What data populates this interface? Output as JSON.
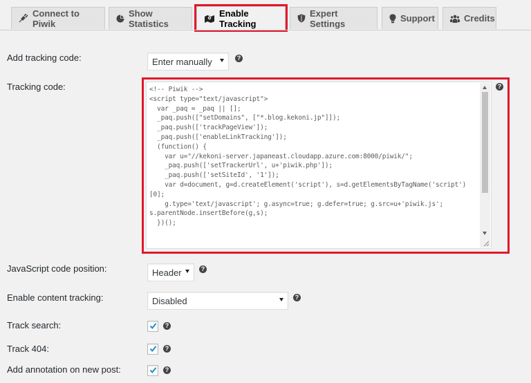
{
  "tabs": [
    {
      "label": "Connect to Piwik",
      "icon": "plug-icon"
    },
    {
      "label": "Show Statistics",
      "icon": "pie-chart-icon"
    },
    {
      "label": "Enable Tracking",
      "icon": "map-icon",
      "active": true
    },
    {
      "label": "Expert Settings",
      "icon": "shield-icon"
    },
    {
      "label": "Support",
      "icon": "lightbulb-icon"
    },
    {
      "label": "Credits",
      "icon": "group-icon"
    }
  ],
  "form": {
    "add_tracking_code": {
      "label": "Add tracking code:",
      "value": "Enter manually"
    },
    "tracking_code": {
      "label": "Tracking code:",
      "value": "<!-- Piwik -->\n<script type=\"text/javascript\">\n  var _paq = _paq || [];\n  _paq.push([\"setDomains\", [\"*.blog.kekoni.jp\"]]);\n  _paq.push(['trackPageView']);\n  _paq.push(['enableLinkTracking']);\n  (function() {\n    var u=\"//kekoni-server.japaneast.cloudapp.azure.com:8000/piwik/\";\n    _paq.push(['setTrackerUrl', u+'piwik.php']);\n    _paq.push(['setSiteId', '1']);\n    var d=document, g=d.createElement('script'), s=d.getElementsByTagName('script')\n[0];\n    g.type='text/javascript'; g.async=true; g.defer=true; g.src=u+'piwik.js';\ns.parentNode.insertBefore(g,s);\n  })();"
    },
    "js_position": {
      "label": "JavaScript code position:",
      "value": "Header"
    },
    "content_tracking": {
      "label": "Enable content tracking:",
      "value": "Disabled"
    },
    "track_search": {
      "label": "Track search:",
      "checked": true
    },
    "track_404": {
      "label": "Track 404:",
      "checked": true
    },
    "annotation": {
      "label": "Add annotation on new post:",
      "checked": true
    }
  },
  "help_glyph": "?",
  "colors": {
    "highlight": "#e0182d",
    "checkmark": "#1e8cbe"
  }
}
